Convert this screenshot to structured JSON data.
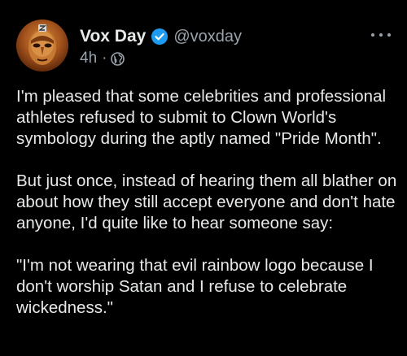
{
  "post": {
    "author": {
      "display_name": "Vox Day",
      "handle": "@voxday",
      "verified": true,
      "avatar_icon": "golden-mask-avatar"
    },
    "meta": {
      "time": "4h",
      "separator": "·",
      "visibility_icon": "globe-icon"
    },
    "more_icon": "more-horizontal-icon",
    "paragraphs": [
      "I'm pleased that some celebrities and professional athletes refused to submit to Clown World's symbology during the aptly named \"Pride Month\".",
      "But just once, instead of hearing them all blather on about how they still accept everyone and don't hate anyone, I'd quite like to hear someone say:",
      "\"I'm not wearing that evil rainbow logo because I don't worship Satan and I refuse to celebrate wickedness.\""
    ]
  },
  "colors": {
    "background": "#000000",
    "text": "#e7e9ea",
    "secondary_text": "#9aa3ad",
    "verified_badge": "#1d9bf0"
  }
}
